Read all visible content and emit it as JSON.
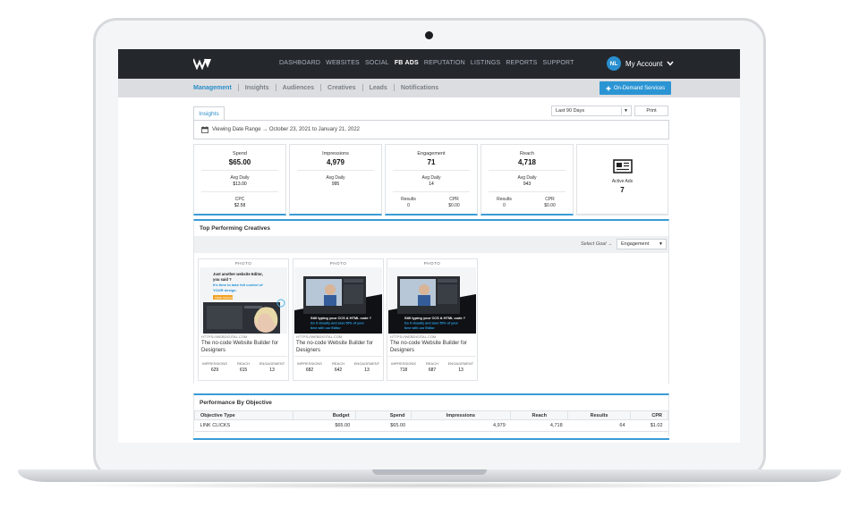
{
  "colors": {
    "accent": "#2b8dc9",
    "nav_bg": "#24282d",
    "subnav_bg": "#dcdde0",
    "card_border": "#3a9bd6"
  },
  "topnav": {
    "links": [
      "DASHBOARD",
      "WEBSITES",
      "SOCIAL",
      "FB ADS",
      "REPUTATION",
      "LISTINGS",
      "REPORTS",
      "SUPPORT"
    ],
    "active": "FB ADS",
    "avatar_initials": "NL",
    "account_label": "My Account"
  },
  "subnav": {
    "links": [
      "Management",
      "Insights",
      "Audiences",
      "Creatives",
      "Leads",
      "Notifications"
    ],
    "active": "Management",
    "on_demand_label": "On-Demand Services"
  },
  "insights": {
    "tab_label": "Insights",
    "range_value": "Last 90 Days",
    "print_label": "Print",
    "date_range_text": "Viewing Date Range → October 23, 2021 to January 21, 2022"
  },
  "stats": {
    "spend": {
      "title": "Spend",
      "value": "$65.00",
      "avg_label": "Avg Daily",
      "avg_value": "$13.00",
      "cpc_label": "CPC",
      "cpc_value": "$2.58"
    },
    "impressions": {
      "title": "Impressions",
      "value": "4,979",
      "avg_label": "Avg Daily",
      "avg_value": "995"
    },
    "engagement": {
      "title": "Engagement",
      "value": "71",
      "avg_label": "Avg Daily",
      "avg_value": "14",
      "results_label": "Results",
      "results_value": "0",
      "cpr_label": "CPR",
      "cpr_value": "$0.00"
    },
    "reach": {
      "title": "Reach",
      "value": "4,718",
      "avg_label": "Avg Daily",
      "avg_value": "943",
      "results_label": "Results",
      "results_value": "0",
      "cpr_label": "CPR",
      "cpr_value": "$0.00"
    },
    "active_ads": {
      "title": "Active Ads",
      "value": "7"
    }
  },
  "creatives": {
    "section_title": "Top Performing Creatives",
    "goal_label": "Select Goal →",
    "goal_value": "Engagement",
    "items": [
      {
        "type": "PHOTO",
        "img_line1": "Just another website Editor,",
        "img_line2": "you said ?",
        "img_line3": "It's time to take full control of",
        "img_line4": "YOUR design.",
        "img_cta": "FREE SIGNUP",
        "url": "HTTPS://WEBDIGITAL.COM",
        "headline": "The no-code Website Builder for Designers",
        "impressions_label": "IMPRESSIONS",
        "impressions": "629",
        "reach_label": "REACH",
        "reach": "615",
        "engagement_label": "ENGAGEMENT",
        "engagement": "13"
      },
      {
        "type": "PHOTO",
        "img_line1": "Still typing your CCS & HTML code ?",
        "img_line2": "Do it visually and save 50% of your",
        "img_line3": "time with our Editor",
        "url": "HTTPS://WEBDIGITAL.COM",
        "headline": "The no-code Website Builder for Designers",
        "impressions_label": "IMPRESSIONS",
        "impressions": "682",
        "reach_label": "REACH",
        "reach": "642",
        "engagement_label": "ENGAGEMENT",
        "engagement": "13"
      },
      {
        "type": "PHOTO",
        "img_line1": "Still typing your CCS & HTML code ?",
        "img_line2": "Do it visually and save 50% of your",
        "img_line3": "time with our Editor",
        "url": "HTTPS://WEBDIGITAL.COM",
        "headline": "The no-code Website Builder for Designers",
        "impressions_label": "IMPRESSIONS",
        "impressions": "718",
        "reach_label": "REACH",
        "reach": "687",
        "engagement_label": "ENGAGEMENT",
        "engagement": "13"
      }
    ]
  },
  "objective": {
    "section_title": "Performance By Objective",
    "columns": [
      "Objective Type",
      "Budget",
      "Spend",
      "Impressions",
      "Reach",
      "Results",
      "CPR"
    ],
    "rows": [
      [
        "LINK CLICKS",
        "$65.00",
        "$65.00",
        "4,979",
        "4,718",
        "64",
        "$1.02"
      ]
    ]
  },
  "icons": {
    "calendar": "calendar-icon",
    "newspaper": "newspaper-icon",
    "plus": "plus-icon",
    "chevron": "chevron-down-icon"
  }
}
